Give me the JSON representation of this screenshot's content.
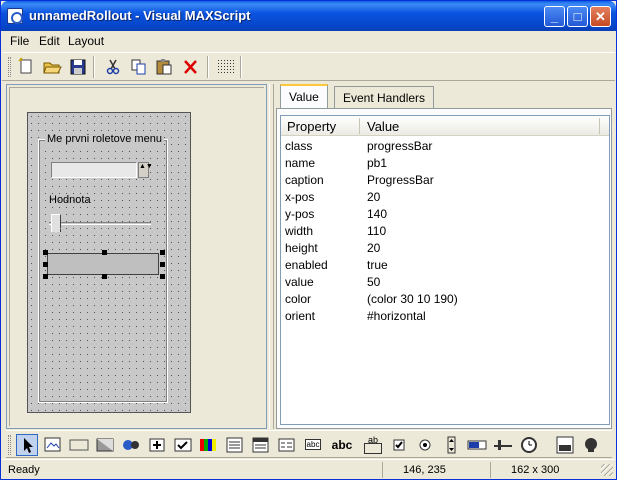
{
  "window": {
    "title": "unnamedRollout - Visual MAXScript",
    "minimize_glyph": "_",
    "maximize_glyph": "□",
    "close_glyph": "✕"
  },
  "menu": {
    "items": [
      {
        "label": "File"
      },
      {
        "label": "Edit"
      },
      {
        "label": "Layout"
      }
    ]
  },
  "toolbar": {
    "icons": [
      "new-icon",
      "open-icon",
      "save-icon",
      "cut-icon",
      "copy-icon",
      "paste-icon",
      "delete-icon",
      "grid-icon"
    ]
  },
  "designer": {
    "group_label": "Me prvni roletove menu",
    "spinner_arrows": "▲▼",
    "slider_label": "Hodnota",
    "progress_value": 0.5,
    "progress_color": "#1E0ABE"
  },
  "tabs": [
    {
      "label": "Value"
    },
    {
      "label": "Event Handlers"
    }
  ],
  "properties": {
    "columns": [
      "Property",
      "Value"
    ],
    "rows": [
      {
        "name": "class",
        "value": "progressBar"
      },
      {
        "name": "name",
        "value": "pb1"
      },
      {
        "name": "caption",
        "value": "ProgressBar"
      },
      {
        "name": "x-pos",
        "value": "20"
      },
      {
        "name": "y-pos",
        "value": "140"
      },
      {
        "name": "width",
        "value": "110"
      },
      {
        "name": "height",
        "value": "20"
      },
      {
        "name": "enabled",
        "value": "true"
      },
      {
        "name": "value",
        "value": "50"
      },
      {
        "name": "color",
        "value": "(color 30 10 190)"
      },
      {
        "name": "orient",
        "value": "#horizontal"
      }
    ]
  },
  "toolbox": {
    "text_tools": {
      "label_tool": "abc",
      "edittext_tool": "ab",
      "small_label": "abc"
    }
  },
  "status": {
    "text": "Ready",
    "cursor_position": "146, 235",
    "canvas_size": "162 x 300"
  }
}
